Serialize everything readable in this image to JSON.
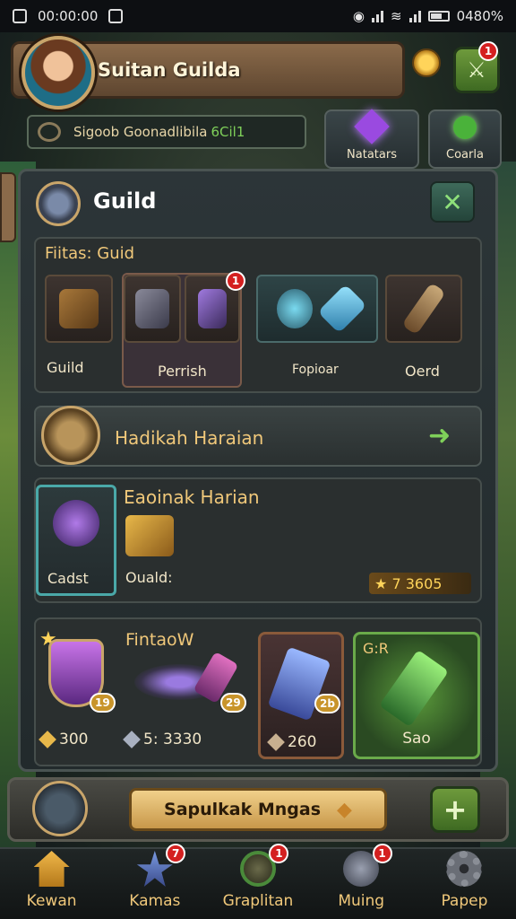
{
  "status_bar": {
    "time": "00:00:00",
    "battery": "0480%"
  },
  "header": {
    "guild_name": "Suitan Guilda",
    "notification_count": "1"
  },
  "subbar": {
    "text": "Sigoob  Goonadlibila",
    "highlight": "6Cil1"
  },
  "top_tiles": [
    {
      "label": "Natatars",
      "icon": "purple-gem-icon"
    },
    {
      "label": "Coarla",
      "icon": "green-orb-icon"
    }
  ],
  "panel": {
    "title": "Guild"
  },
  "features": {
    "heading": "Fiitas: Guid",
    "items": [
      {
        "label": "Guild",
        "icon": "treasure-chest-icon"
      },
      {
        "label": "Perrish",
        "icon": "weapon-bundle-icon",
        "badge": "1"
      },
      {
        "label": "Fopioar",
        "icon": "crystal-amulet-icon"
      },
      {
        "label": "Oerd",
        "icon": "dagger-icon"
      }
    ]
  },
  "daily": {
    "title": "Hadikah Haraian"
  },
  "reward": {
    "card_label": "Cadst",
    "title": "Eaoinak Harian",
    "sub_label": "Ouald:",
    "score": "7 3605"
  },
  "shop": {
    "title": "FintaoW",
    "corner_label": "G:R",
    "items": [
      {
        "price": "300",
        "level": "19",
        "icon": "purple-shield-icon"
      },
      {
        "price": "5: 3330",
        "level": "29",
        "icon": "magic-wand-icon"
      },
      {
        "price": "260",
        "level": "2b",
        "icon": "blue-crystal-blade-icon"
      },
      {
        "price": "Sao",
        "icon": "green-crystal-sword-icon"
      }
    ]
  },
  "bottom_action": {
    "button_label": "Sapulkak Mngas"
  },
  "nav": [
    {
      "label": "Kewan",
      "icon": "home-icon"
    },
    {
      "label": "Kamas",
      "icon": "star-crystal-icon",
      "badge": "7"
    },
    {
      "label": "Graplitan",
      "icon": "compass-icon",
      "badge": "1"
    },
    {
      "label": "Muing",
      "icon": "sword-icon",
      "badge": "1"
    },
    {
      "label": "Papep",
      "icon": "gear-icon"
    }
  ],
  "colors": {
    "accent_gold": "#f0c87a",
    "badge_red": "#d42020",
    "action_green": "#6e9a3c"
  }
}
